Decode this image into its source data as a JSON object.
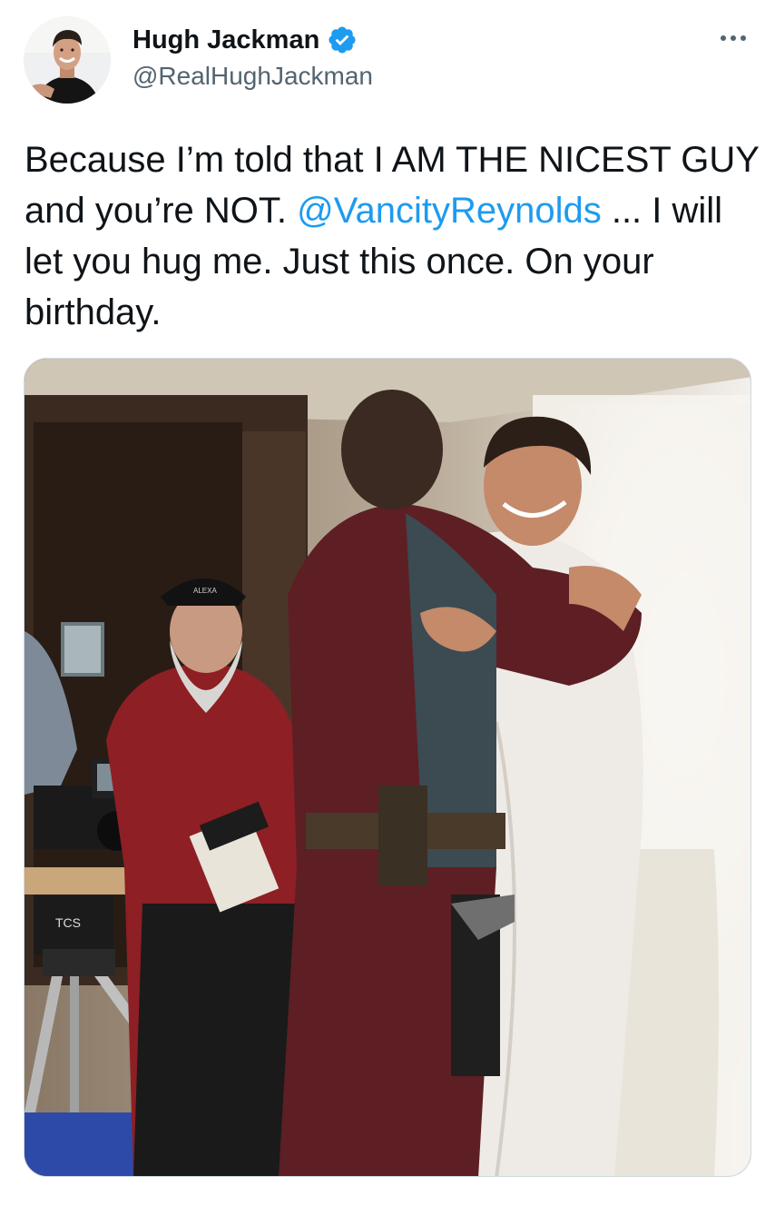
{
  "author": {
    "name": "Hugh Jackman",
    "handle": "@RealHughJackman",
    "verified": true,
    "avatar_icon": "avatar-photo"
  },
  "menu": {
    "icon": "more-options-icon"
  },
  "tweet": {
    "text_part1": "Because I’m told that I AM THE NICEST GUY and you’re NOT. ",
    "mention": "@VancityReynolds",
    "text_part2": " ... I will let you hug me. Just this once. On your birthday."
  },
  "media": {
    "camera_label": "TCS",
    "cap_label": "ALEXA"
  },
  "colors": {
    "link": "#1d9bf0",
    "verified": "#1d9bf0",
    "handle": "#536471",
    "text": "#0f1419"
  }
}
